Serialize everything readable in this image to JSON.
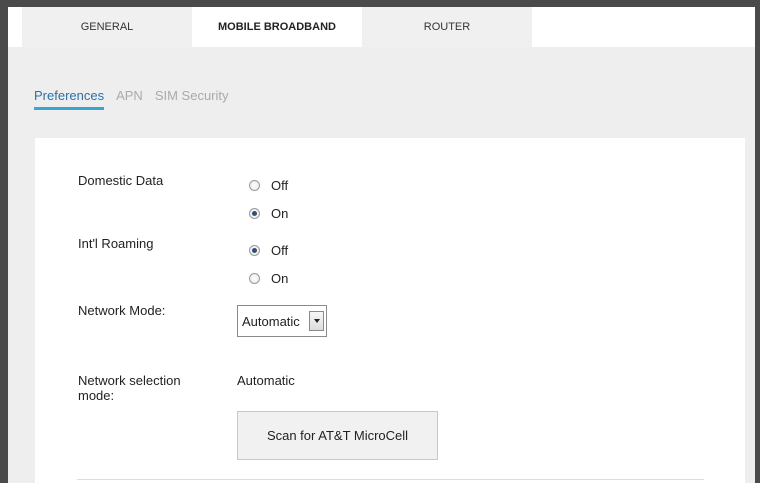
{
  "top_tabs": [
    {
      "label": "GENERAL"
    },
    {
      "label": "MOBILE BROADBAND"
    },
    {
      "label": "ROUTER"
    }
  ],
  "sub_tabs": [
    {
      "label": "Preferences"
    },
    {
      "label": "APN"
    },
    {
      "label": "SIM Security"
    }
  ],
  "form": {
    "domestic_data": {
      "label": "Domestic Data",
      "options": [
        "Off",
        "On"
      ],
      "selected": "On"
    },
    "intl_roaming": {
      "label": "Int'l Roaming",
      "options": [
        "Off",
        "On"
      ],
      "selected": "Off"
    },
    "network_mode": {
      "label": "Network Mode:",
      "value": "Automatic"
    },
    "network_selection": {
      "label": "Network selection mode:",
      "value": "Automatic"
    },
    "scan_button": "Scan for AT&T MicroCell"
  }
}
